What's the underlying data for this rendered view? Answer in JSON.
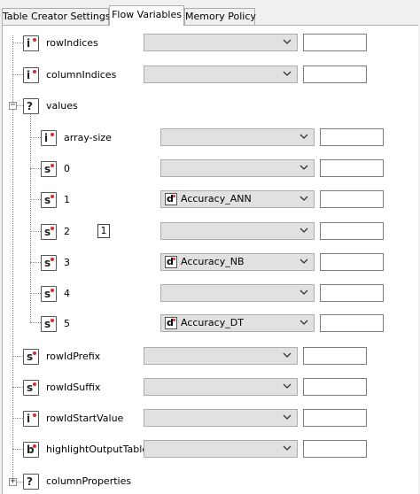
{
  "tabs": [
    {
      "label": "Table Creator Settings",
      "active": false
    },
    {
      "label": "Flow Variables",
      "active": true
    },
    {
      "label": "Memory Policy",
      "active": false
    }
  ],
  "rows": [
    {
      "label": "rowIndices",
      "type_glyph": "i",
      "icon": "integer-array-variable-icon",
      "selected": ""
    },
    {
      "label": "columnIndices",
      "type_glyph": "i",
      "icon": "integer-array-variable-icon",
      "selected": ""
    },
    {
      "label": "values",
      "type_glyph": "?",
      "icon": "unknown-type-icon",
      "expander": "−"
    },
    {
      "label": "array-size",
      "type_glyph": "i",
      "icon": "integer-variable-icon",
      "selected": ""
    },
    {
      "label": "0",
      "type_glyph": "s",
      "icon": "string-variable-icon",
      "selected": ""
    },
    {
      "label": "1",
      "type_glyph": "s",
      "icon": "string-variable-icon",
      "selected": "Accuracy_ANN",
      "selected_glyph": "d"
    },
    {
      "label": "2",
      "type_glyph": "s",
      "icon": "string-variable-icon",
      "selected": "",
      "badge": "1"
    },
    {
      "label": "3",
      "type_glyph": "s",
      "icon": "string-variable-icon",
      "selected": "Accuracy_NB",
      "selected_glyph": "d"
    },
    {
      "label": "4",
      "type_glyph": "s",
      "icon": "string-variable-icon",
      "selected": ""
    },
    {
      "label": "5",
      "type_glyph": "s",
      "icon": "string-variable-icon",
      "selected": "Accuracy_DT",
      "selected_glyph": "d"
    },
    {
      "label": "rowIdPrefix",
      "type_glyph": "s",
      "icon": "string-variable-icon",
      "selected": ""
    },
    {
      "label": "rowIdSuffix",
      "type_glyph": "s",
      "icon": "string-variable-icon",
      "selected": ""
    },
    {
      "label": "rowIdStartValue",
      "type_glyph": "i",
      "icon": "integer-variable-icon",
      "selected": ""
    },
    {
      "label": "highlightOutputTable",
      "type_glyph": "b",
      "icon": "boolean-variable-icon",
      "selected": ""
    },
    {
      "label": "columnProperties",
      "type_glyph": "?",
      "icon": "unknown-type-icon",
      "expander": "+"
    }
  ],
  "colors": {
    "variable_dot": "#e2262f",
    "combo_bg": "#e1e1e1",
    "panel_bg": "#ffffff"
  }
}
